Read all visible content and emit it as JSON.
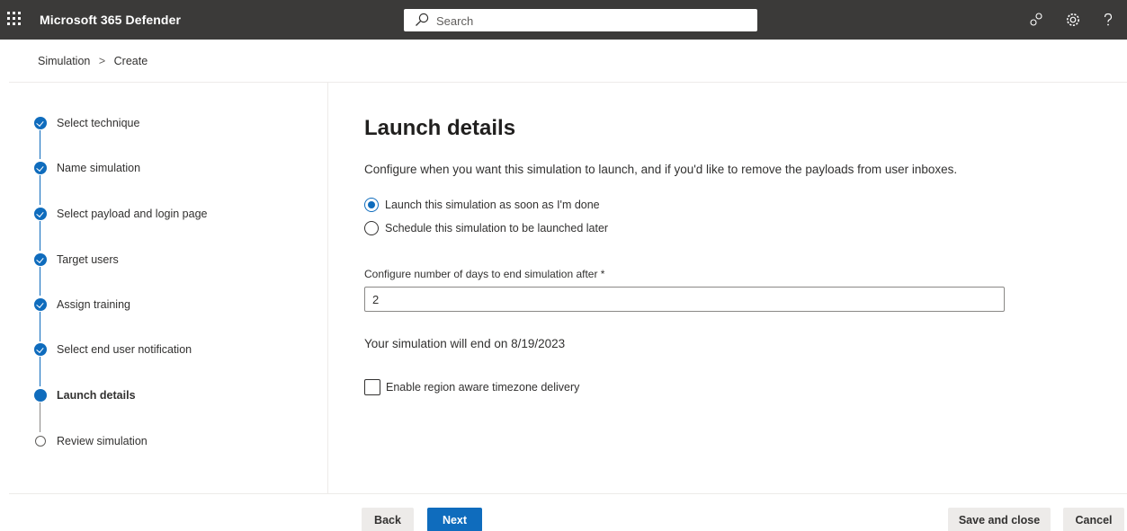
{
  "header": {
    "app_title": "Microsoft 365 Defender",
    "search_placeholder": "Search",
    "icons": [
      "waffle-icon",
      "search-icon",
      "community-icon",
      "settings-gear-icon",
      "help-question-icon"
    ],
    "bar_color": "#3b3a39"
  },
  "breadcrumb": {
    "items": [
      "Simulation",
      "Create"
    ],
    "separator": ">"
  },
  "wizard": {
    "steps": [
      {
        "label": "Select technique",
        "status": "completed"
      },
      {
        "label": "Name simulation",
        "status": "completed"
      },
      {
        "label": "Select payload and login page",
        "status": "completed"
      },
      {
        "label": "Target users",
        "status": "completed"
      },
      {
        "label": "Assign training",
        "status": "completed"
      },
      {
        "label": "Select end user notification",
        "status": "completed"
      },
      {
        "label": "Launch details",
        "status": "current"
      },
      {
        "label": "Review simulation",
        "status": "pending"
      }
    ],
    "accent_color": "#0f6cbd"
  },
  "main": {
    "title": "Launch details",
    "description": "Configure when you want this simulation to launch, and if you'd like to remove the payloads from user inboxes.",
    "launch_options": [
      {
        "label": "Launch this simulation as soon as I'm done",
        "selected": true
      },
      {
        "label": "Schedule this simulation to be launched later",
        "selected": false
      }
    ],
    "days_field": {
      "label": "Configure number of days to end simulation after *",
      "value": "2"
    },
    "end_text": "Your simulation will end on 8/19/2023",
    "region_checkbox": {
      "label": "Enable region aware timezone delivery",
      "checked": false
    }
  },
  "footer": {
    "back_label": "Back",
    "next_label": "Next",
    "save_close_label": "Save and close",
    "cancel_label": "Cancel"
  }
}
